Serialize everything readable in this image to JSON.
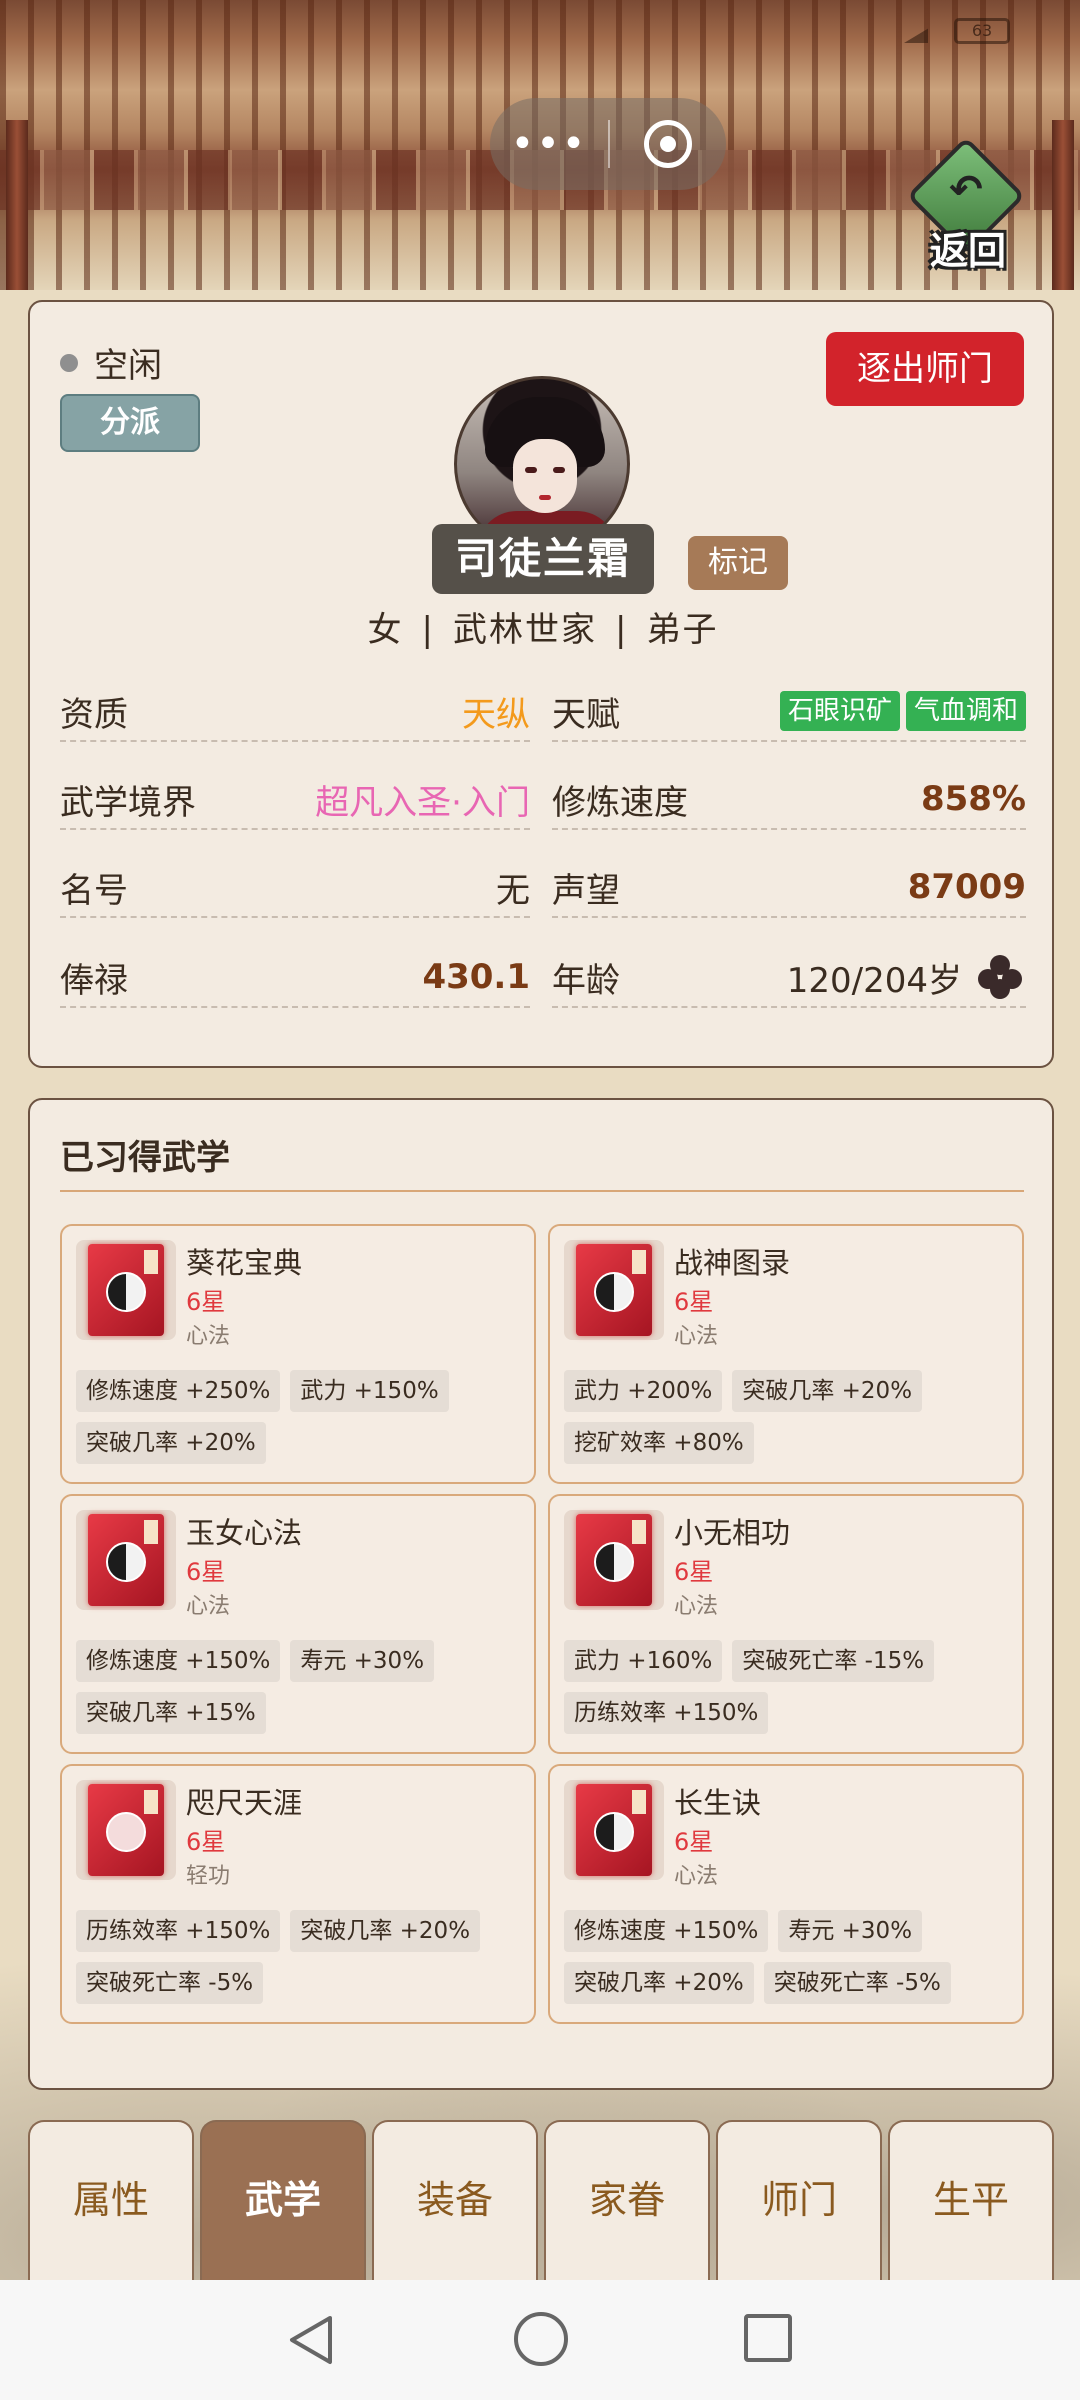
{
  "status_bar": {
    "left": "",
    "battery": "63"
  },
  "capsule": {
    "more": "•••"
  },
  "header": {
    "return_label": "返回"
  },
  "profile": {
    "status": "空闲",
    "faction_button": "分派",
    "expel_button": "逐出师门",
    "name": "司徒兰霜",
    "mark_button": "标记",
    "gender": "女",
    "family": "武林世家",
    "rank": "弟子",
    "separator": "|",
    "attributes": {
      "aptitude_label": "资质",
      "aptitude_value": "天纵",
      "talent_label": "天赋",
      "talents": [
        "石眼识矿",
        "气血调和"
      ],
      "realm_label": "武学境界",
      "realm_value": "超凡入圣·入门",
      "speed_label": "修炼速度",
      "speed_value": "858%",
      "title_label": "名号",
      "title_value": "无",
      "fame_label": "声望",
      "fame_value": "87009",
      "salary_label": "俸禄",
      "salary_value": "430.1",
      "age_label": "年龄",
      "age_value": "120/204岁"
    }
  },
  "skills": {
    "title": "已习得武学",
    "cards": [
      {
        "name": "葵花宝典",
        "stars": "6星",
        "type": "心法",
        "bonuses": [
          "修炼速度 +250%",
          "武力 +150%",
          "突破几率 +20%"
        ]
      },
      {
        "name": "战神图录",
        "stars": "6星",
        "type": "心法",
        "bonuses": [
          "武力 +200%",
          "突破几率 +20%",
          "挖矿效率 +80%"
        ]
      },
      {
        "name": "玉女心法",
        "stars": "6星",
        "type": "心法",
        "bonuses": [
          "修炼速度 +150%",
          "寿元 +30%",
          "突破几率 +15%"
        ]
      },
      {
        "name": "小无相功",
        "stars": "6星",
        "type": "心法",
        "bonuses": [
          "武力 +160%",
          "突破死亡率 -15%",
          "历练效率 +150%"
        ]
      },
      {
        "name": "咫尺天涯",
        "stars": "6星",
        "type": "轻功",
        "bonuses": [
          "历练效率 +150%",
          "突破几率 +20%",
          "突破死亡率 -5%"
        ]
      },
      {
        "name": "长生诀",
        "stars": "6星",
        "type": "心法",
        "bonuses": [
          "修炼速度 +150%",
          "寿元 +30%",
          "突破几率 +20%",
          "突破死亡率 -5%"
        ]
      }
    ]
  },
  "tabs": [
    {
      "label": "属性",
      "active": false
    },
    {
      "label": "武学",
      "active": true
    },
    {
      "label": "装备",
      "active": false
    },
    {
      "label": "家眷",
      "active": false
    },
    {
      "label": "师门",
      "active": false
    },
    {
      "label": "生平",
      "active": false
    }
  ],
  "colors": {
    "expel": "#d2232b",
    "talent": "#34b153",
    "active_tab": "#9a7053",
    "realm": "#e866b3",
    "aptitude": "#f39a1c"
  }
}
